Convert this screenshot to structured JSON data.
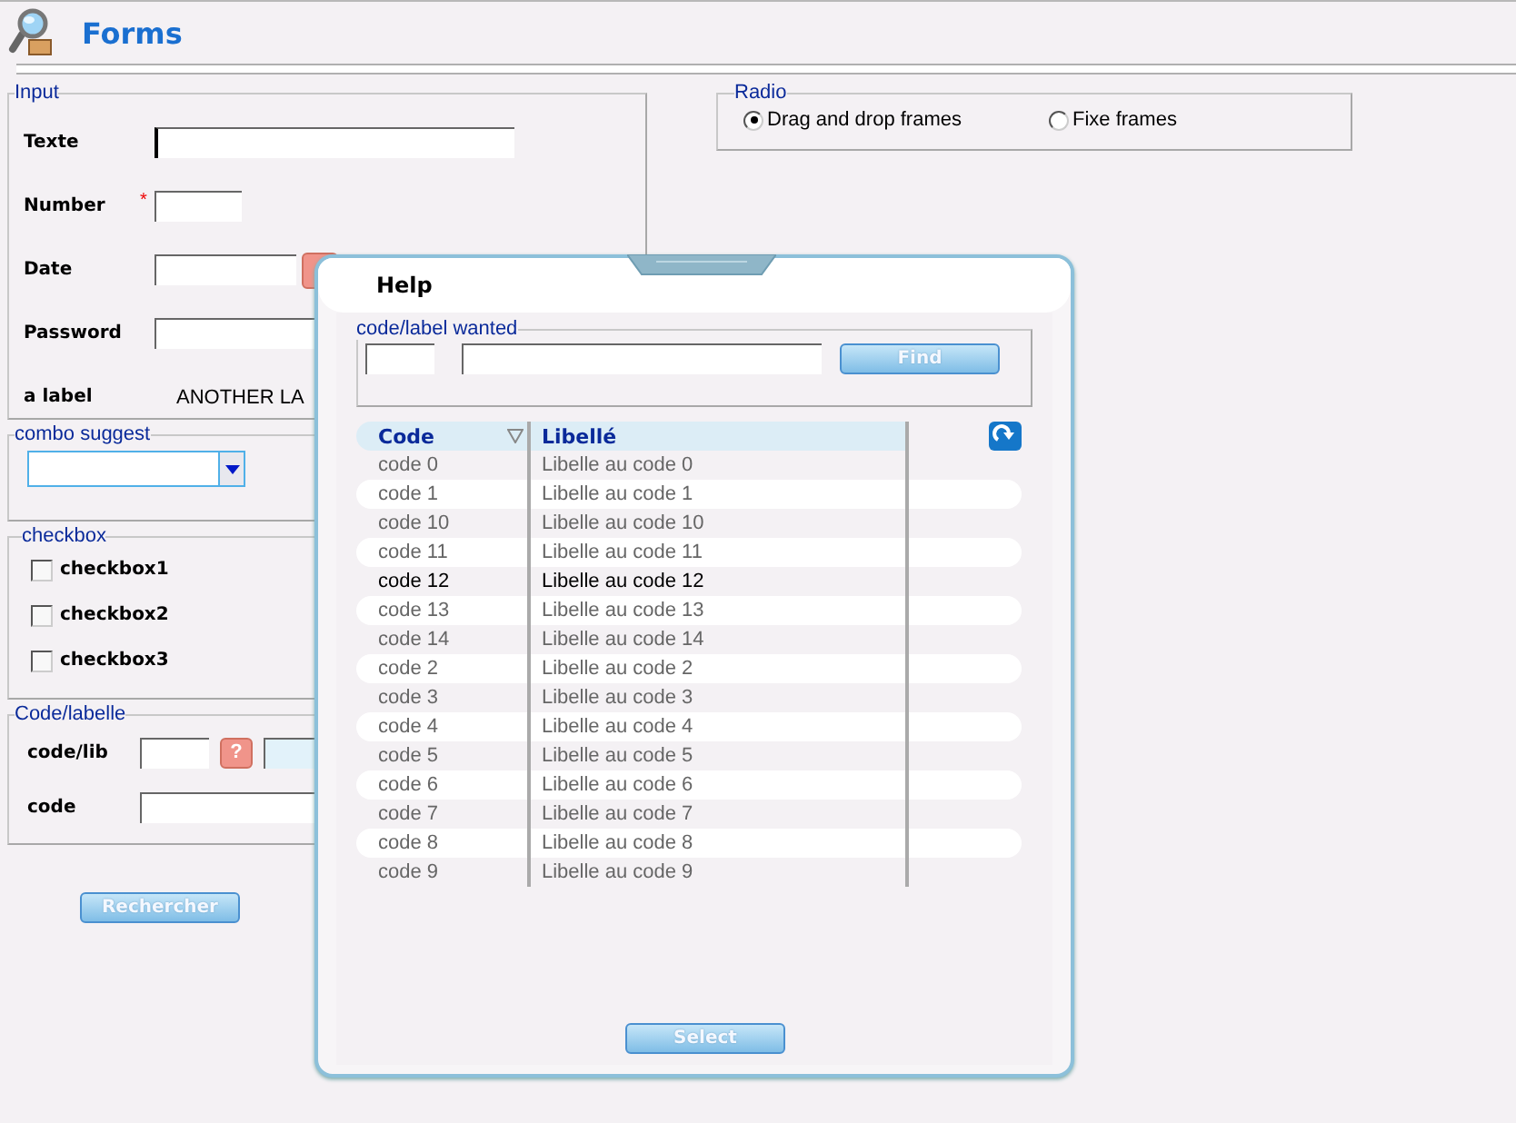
{
  "page": {
    "title": "Forms"
  },
  "input_group": {
    "legend": "Input",
    "fields": [
      {
        "label": "Texte",
        "kind": "text",
        "focused": true
      },
      {
        "label": "Number",
        "kind": "number",
        "marker": "*"
      },
      {
        "label": "Date",
        "kind": "date"
      },
      {
        "label": "Password",
        "kind": "password"
      },
      {
        "label": "a label",
        "kind": "label",
        "value": "ANOTHER LA"
      }
    ]
  },
  "combo_group": {
    "legend": "combo suggest"
  },
  "checkbox_group": {
    "legend": "checkbox",
    "items": [
      {
        "label": "checkbox1",
        "checked": false
      },
      {
        "label": "checkbox2",
        "checked": false
      },
      {
        "label": "checkbox3",
        "checked": false
      }
    ]
  },
  "code_group": {
    "legend": "Code/labelle",
    "fields": [
      {
        "label": "code/lib",
        "kind": "lookup",
        "help_glyph": "?"
      },
      {
        "label": "code",
        "kind": "text"
      }
    ]
  },
  "search_button": "Rechercher",
  "radio_group": {
    "legend": "Radio",
    "options": [
      {
        "label": "Drag and drop frames",
        "selected": true
      },
      {
        "label": "Fixe frames",
        "selected": false
      }
    ]
  },
  "dialog": {
    "title": "Help",
    "search_legend": "code/label wanted",
    "find_button": "Find",
    "columns": [
      {
        "label": "Code",
        "sorted": true
      },
      {
        "label": "Libellé",
        "sorted": false
      }
    ],
    "rows": [
      {
        "code": "code 0",
        "label": "Libelle au code 0",
        "selected": false
      },
      {
        "code": "code 1",
        "label": "Libelle au code 1",
        "selected": false
      },
      {
        "code": "code 10",
        "label": "Libelle au code 10",
        "selected": false
      },
      {
        "code": "code 11",
        "label": "Libelle au code 11",
        "selected": false
      },
      {
        "code": "code 12",
        "label": "Libelle au code 12",
        "selected": true
      },
      {
        "code": "code 13",
        "label": "Libelle au code 13",
        "selected": false
      },
      {
        "code": "code 14",
        "label": "Libelle au code 14",
        "selected": false
      },
      {
        "code": "code 2",
        "label": "Libelle au code 2",
        "selected": false
      },
      {
        "code": "code 3",
        "label": "Libelle au code 3",
        "selected": false
      },
      {
        "code": "code 4",
        "label": "Libelle au code 4",
        "selected": false
      },
      {
        "code": "code 5",
        "label": "Libelle au code 5",
        "selected": false
      },
      {
        "code": "code 6",
        "label": "Libelle au code 6",
        "selected": false
      },
      {
        "code": "code 7",
        "label": "Libelle au code 7",
        "selected": false
      },
      {
        "code": "code 8",
        "label": "Libelle au code 8",
        "selected": false
      },
      {
        "code": "code 9",
        "label": "Libelle au code 9",
        "selected": false
      }
    ],
    "select_button": "Select"
  }
}
